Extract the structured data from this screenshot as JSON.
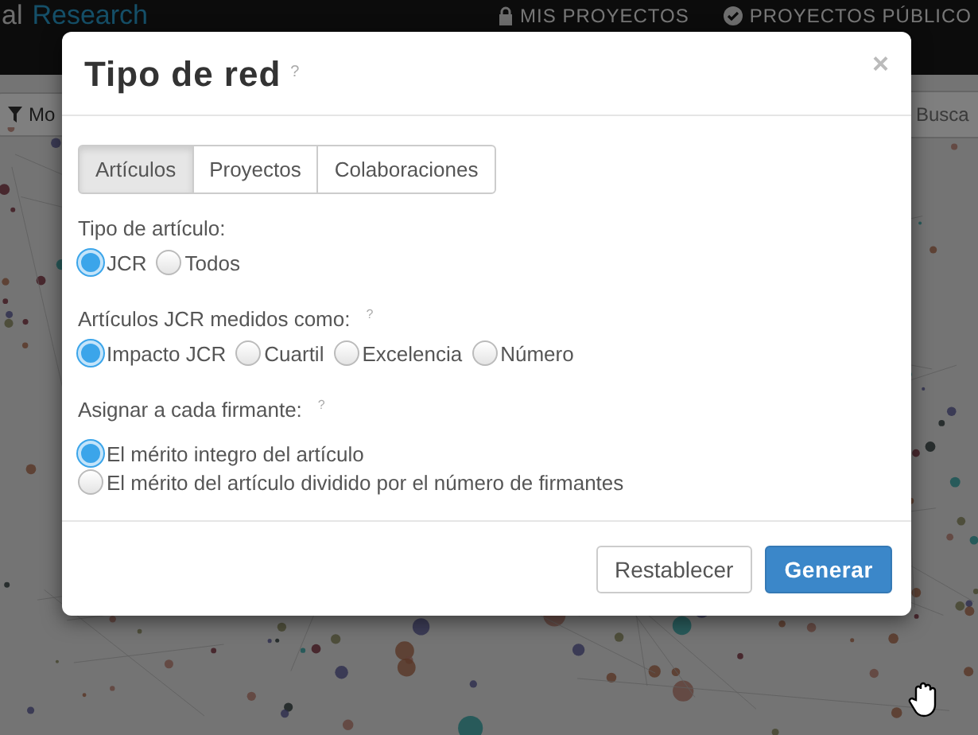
{
  "header": {
    "brand_prefix": "al",
    "brand_highlight": "Research",
    "nav": [
      {
        "kind": "lock",
        "label": "MIS PROYECTOS"
      },
      {
        "kind": "check",
        "label": "PROYECTOS PÚBLICO"
      }
    ]
  },
  "toolbar": {
    "filter_button": "Mo",
    "search": {
      "placeholder": "Busca"
    }
  },
  "dialog": {
    "title": "Tipo de red",
    "help": "?",
    "close": "×",
    "tabs": [
      {
        "label": "Artículos",
        "selected": true
      },
      {
        "label": "Proyectos",
        "selected": false
      },
      {
        "label": "Colaboraciones",
        "selected": false
      }
    ],
    "groups": [
      {
        "label": "Tipo de artículo:",
        "kind": "inline",
        "options": [
          {
            "label": "JCR",
            "selected": true
          },
          {
            "label": "Todos",
            "selected": false
          }
        ]
      },
      {
        "label": "Artículos JCR medidos como:",
        "help": "?",
        "kind": "inline",
        "options": [
          {
            "label": "Impacto JCR",
            "selected": true
          },
          {
            "label": "Cuartil",
            "selected": false
          },
          {
            "label": "Excelencia",
            "selected": false
          },
          {
            "label": "Número",
            "selected": false
          }
        ]
      },
      {
        "label": "Asignar a cada firmante:",
        "help": "?",
        "kind": "stacked",
        "options": [
          {
            "label": "El mérito integro del artículo",
            "selected": true
          },
          {
            "label": "El mérito del artículo dividido por el número de firmantes",
            "selected": false
          }
        ]
      }
    ],
    "buttons": [
      {
        "kind": "default",
        "label": "Restablecer"
      },
      {
        "kind": "primary",
        "label": "Generar"
      }
    ]
  }
}
